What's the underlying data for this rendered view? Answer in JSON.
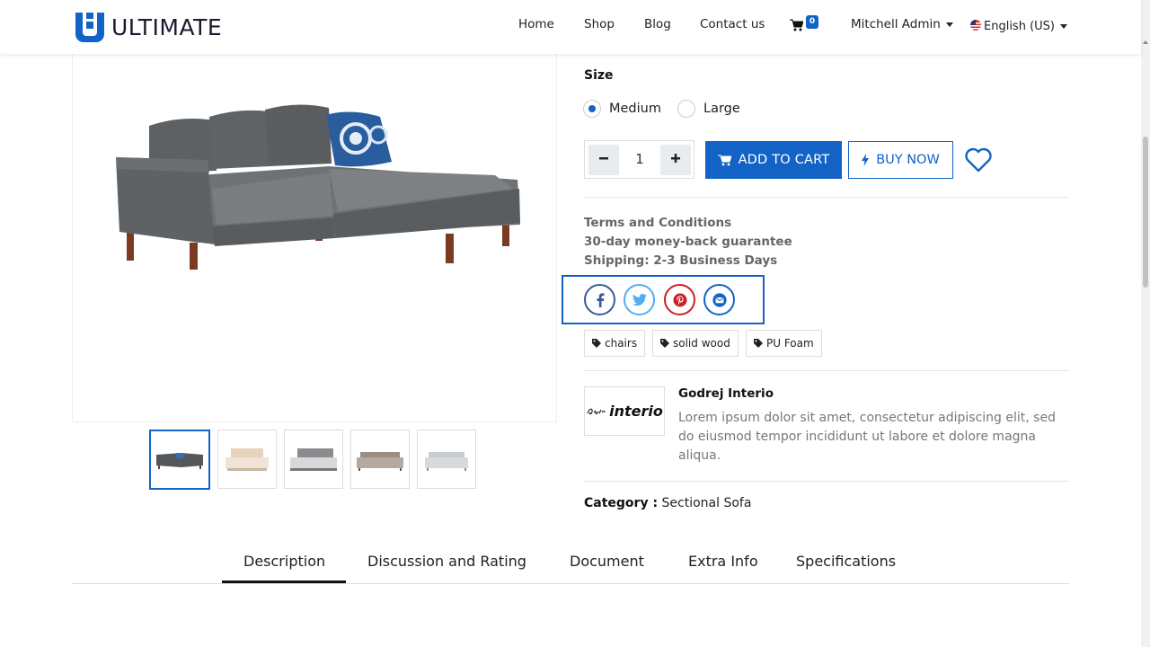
{
  "header": {
    "brand": "ULTIMATE",
    "nav": {
      "home": "Home",
      "shop": "Shop",
      "blog": "Blog",
      "contact": "Contact us",
      "cart_count": "0",
      "user": "Mitchell Admin",
      "language": "English (US)"
    }
  },
  "product": {
    "size_label": "Size",
    "size_options": [
      "Medium",
      "Large"
    ],
    "selected_size": "Medium",
    "quantity": "1",
    "add_to_cart": "ADD TO CART",
    "buy_now": "BUY NOW",
    "terms": [
      "Terms and Conditions",
      "30-day money-back guarantee",
      "Shipping: 2-3 Business Days"
    ],
    "tags": [
      "chairs",
      "solid wood",
      "PU Foam"
    ],
    "brand": {
      "logo_text": "interio",
      "name": "Godrej Interio",
      "description": "Lorem ipsum dolor sit amet, consectetur adipiscing elit, sed do eiusmod tempor incididunt ut labore et dolore magna aliqua."
    },
    "category_label": "Category :",
    "category_value": "Sectional Sofa"
  },
  "share": {
    "facebook_color": "#3b5998",
    "twitter_color": "#55acee",
    "pinterest_color": "#cb2027",
    "email_color": "#1363c6"
  },
  "tabs": [
    "Description",
    "Discussion and Rating",
    "Document",
    "Extra Info",
    "Specifications"
  ],
  "active_tab": "Description",
  "colors": {
    "accent": "#1363c6"
  }
}
